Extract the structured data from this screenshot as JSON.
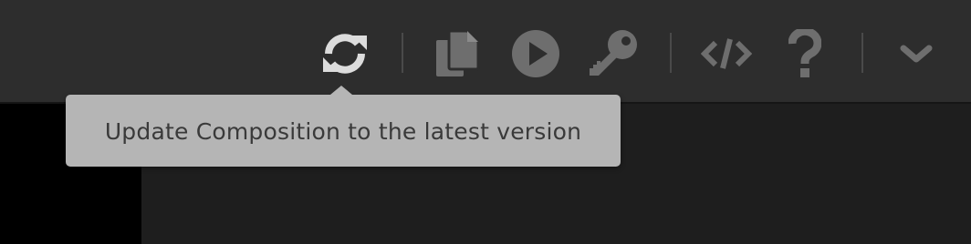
{
  "toolbar": {
    "buttons": [
      {
        "icon": "refresh-icon",
        "label": "Update Composition"
      },
      {
        "icon": "copy-icon",
        "label": "Duplicate"
      },
      {
        "icon": "play-icon",
        "label": "Preview"
      },
      {
        "icon": "key-icon",
        "label": "Access"
      },
      {
        "icon": "code-icon",
        "label": "Embed code"
      },
      {
        "icon": "help-icon",
        "label": "Help"
      },
      {
        "icon": "chevron-down-icon",
        "label": "More"
      }
    ]
  },
  "tooltip": {
    "text": "Update Composition to the latest version"
  },
  "colors": {
    "toolbar_bg": "#2d2d2d",
    "active_icon": "#dcdcdc",
    "inactive_icon": "#6e6e6e",
    "tooltip_bg": "#b5b5b5",
    "tooltip_text": "#3a3a3a"
  }
}
